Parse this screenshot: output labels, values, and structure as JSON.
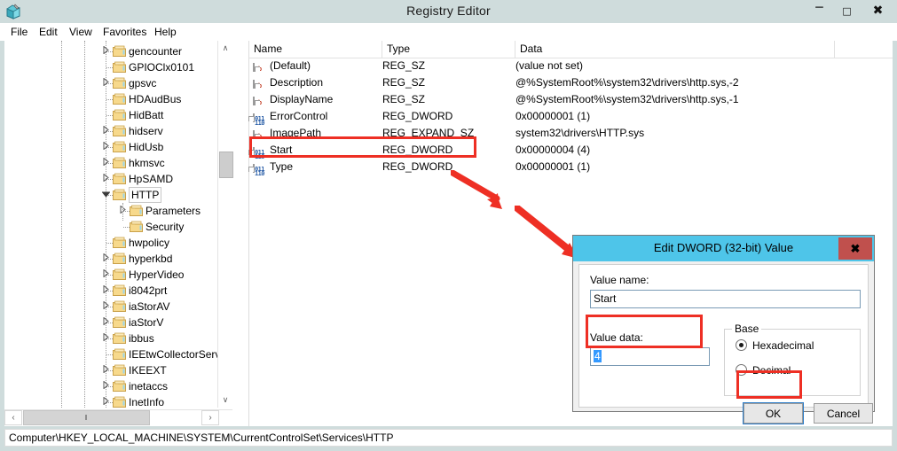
{
  "window": {
    "title": "Registry Editor",
    "icon": "registry-editor-icon",
    "minimize_label": "–",
    "maximize_label": "□",
    "close_label": "✖"
  },
  "menubar": {
    "items": [
      {
        "label": "File"
      },
      {
        "label": "Edit"
      },
      {
        "label": "View"
      },
      {
        "label": "Favorites"
      },
      {
        "label": "Help"
      }
    ]
  },
  "tree": {
    "nodes": [
      {
        "label": "gencounter",
        "depth": 2,
        "expander": "collapsed",
        "selected": false
      },
      {
        "label": "GPIOClx0101",
        "depth": 2,
        "expander": "none",
        "selected": false
      },
      {
        "label": "gpsvc",
        "depth": 2,
        "expander": "collapsed",
        "selected": false
      },
      {
        "label": "HDAudBus",
        "depth": 2,
        "expander": "none",
        "selected": false
      },
      {
        "label": "HidBatt",
        "depth": 2,
        "expander": "none",
        "selected": false
      },
      {
        "label": "hidserv",
        "depth": 2,
        "expander": "collapsed",
        "selected": false
      },
      {
        "label": "HidUsb",
        "depth": 2,
        "expander": "collapsed",
        "selected": false
      },
      {
        "label": "hkmsvc",
        "depth": 2,
        "expander": "collapsed",
        "selected": false
      },
      {
        "label": "HpSAMD",
        "depth": 2,
        "expander": "collapsed",
        "selected": false
      },
      {
        "label": "HTTP",
        "depth": 2,
        "expander": "expanded",
        "selected": true
      },
      {
        "label": "Parameters",
        "depth": 3,
        "expander": "collapsed",
        "selected": false
      },
      {
        "label": "Security",
        "depth": 3,
        "expander": "none",
        "selected": false
      },
      {
        "label": "hwpolicy",
        "depth": 2,
        "expander": "none",
        "selected": false
      },
      {
        "label": "hyperkbd",
        "depth": 2,
        "expander": "collapsed",
        "selected": false
      },
      {
        "label": "HyperVideo",
        "depth": 2,
        "expander": "collapsed",
        "selected": false
      },
      {
        "label": "i8042prt",
        "depth": 2,
        "expander": "collapsed",
        "selected": false
      },
      {
        "label": "iaStorAV",
        "depth": 2,
        "expander": "collapsed",
        "selected": false
      },
      {
        "label": "iaStorV",
        "depth": 2,
        "expander": "collapsed",
        "selected": false
      },
      {
        "label": "ibbus",
        "depth": 2,
        "expander": "collapsed",
        "selected": false
      },
      {
        "label": "IEEtwCollectorService",
        "depth": 2,
        "expander": "none",
        "selected": false
      },
      {
        "label": "IKEEXT",
        "depth": 2,
        "expander": "collapsed",
        "selected": false
      },
      {
        "label": "inetaccs",
        "depth": 2,
        "expander": "collapsed",
        "selected": false
      },
      {
        "label": "InetInfo",
        "depth": 2,
        "expander": "collapsed",
        "selected": false
      }
    ],
    "scroll_up_glyph": "∧",
    "scroll_down_glyph": "∨",
    "scroll_left_glyph": "‹",
    "scroll_right_glyph": "›",
    "hthumb_glyph": "‖"
  },
  "list": {
    "columns": [
      "Name",
      "Type",
      "Data"
    ],
    "rows": [
      {
        "icon": "string-value-icon",
        "name": "(Default)",
        "type": "REG_SZ",
        "data": "(value not set)"
      },
      {
        "icon": "string-value-icon",
        "name": "Description",
        "type": "REG_SZ",
        "data": "@%SystemRoot%\\system32\\drivers\\http.sys,-2"
      },
      {
        "icon": "string-value-icon",
        "name": "DisplayName",
        "type": "REG_SZ",
        "data": "@%SystemRoot%\\system32\\drivers\\http.sys,-1"
      },
      {
        "icon": "dword-value-icon",
        "name": "ErrorControl",
        "type": "REG_DWORD",
        "data": "0x00000001 (1)"
      },
      {
        "icon": "string-value-icon",
        "name": "ImagePath",
        "type": "REG_EXPAND_SZ",
        "data": "system32\\drivers\\HTTP.sys"
      },
      {
        "icon": "dword-value-icon",
        "name": "Start",
        "type": "REG_DWORD",
        "data": "0x00000004 (4)"
      },
      {
        "icon": "dword-value-icon",
        "name": "Type",
        "type": "REG_DWORD",
        "data": "0x00000001 (1)"
      }
    ],
    "highlighted_row_name": "Start"
  },
  "statusbar": {
    "path": "Computer\\HKEY_LOCAL_MACHINE\\SYSTEM\\CurrentControlSet\\Services\\HTTP"
  },
  "dialog": {
    "title": "Edit DWORD (32-bit) Value",
    "close_label": "✖",
    "value_name_label": "Value name:",
    "value_name": "Start",
    "value_data_label": "Value data:",
    "value_data": "4",
    "base_legend": "Base",
    "base_options": [
      {
        "label": "Hexadecimal",
        "selected": true
      },
      {
        "label": "Decimal",
        "selected": false
      }
    ],
    "ok_label": "OK",
    "cancel_label": "Cancel"
  },
  "annotations": {
    "colors": {
      "highlight": "#ee2f24",
      "dialog_title": "#4ec5e9",
      "dialog_close": "#c0504d",
      "selection": "#3399ff"
    },
    "arrows": [
      {
        "name": "arrow-to-dialog-1"
      },
      {
        "name": "arrow-to-dialog-2"
      },
      {
        "name": "arrow-to-ok-button"
      }
    ]
  }
}
